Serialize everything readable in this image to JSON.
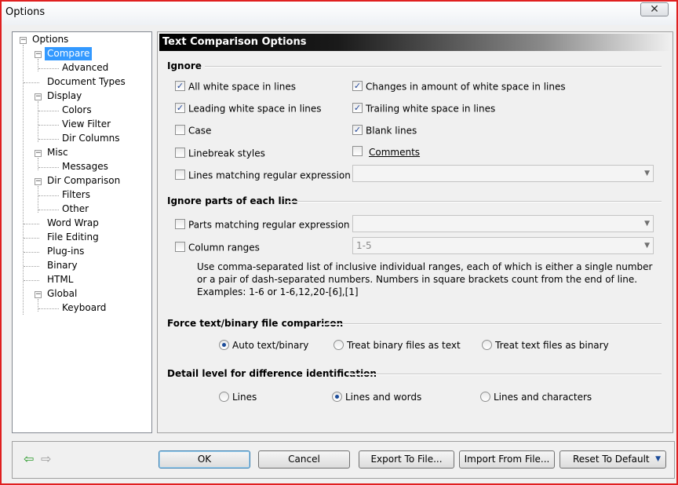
{
  "window": {
    "title": "Options",
    "close_symbol": "✕"
  },
  "tree": {
    "items": [
      {
        "label": "Options",
        "level": 0,
        "expander": "−"
      },
      {
        "label": "Compare",
        "level": 1,
        "expander": "−",
        "selected": true
      },
      {
        "label": "Advanced",
        "level": 2
      },
      {
        "label": "Document Types",
        "level": 1
      },
      {
        "label": "Display",
        "level": 1,
        "expander": "−"
      },
      {
        "label": "Colors",
        "level": 2
      },
      {
        "label": "View Filter",
        "level": 2
      },
      {
        "label": "Dir Columns",
        "level": 2
      },
      {
        "label": "Misc",
        "level": 1,
        "expander": "−"
      },
      {
        "label": "Messages",
        "level": 2
      },
      {
        "label": "Dir Comparison",
        "level": 1,
        "expander": "−"
      },
      {
        "label": "Filters",
        "level": 2
      },
      {
        "label": "Other",
        "level": 2
      },
      {
        "label": "Word Wrap",
        "level": 1
      },
      {
        "label": "File Editing",
        "level": 1
      },
      {
        "label": "Plug-ins",
        "level": 1
      },
      {
        "label": "Binary",
        "level": 1
      },
      {
        "label": "HTML",
        "level": 1
      },
      {
        "label": "Global",
        "level": 1,
        "expander": "−"
      },
      {
        "label": "Keyboard",
        "level": 2
      }
    ]
  },
  "panel": {
    "header": "Text Comparison Options",
    "ignore": {
      "title": "Ignore",
      "all_white_space": {
        "label": "All white space in lines",
        "checked": true
      },
      "changes_white_space": {
        "label": "Changes in amount of white space in lines",
        "checked": true
      },
      "leading_white_space": {
        "label": "Leading white space in lines",
        "checked": true
      },
      "trailing_white_space": {
        "label": "Trailing white space in lines",
        "checked": true
      },
      "case": {
        "label": "Case",
        "checked": false
      },
      "blank_lines": {
        "label": "Blank lines",
        "checked": true
      },
      "linebreak_styles": {
        "label": "Linebreak styles",
        "checked": false
      },
      "comments": {
        "label": "Comments",
        "checked": false
      },
      "lines_matching_regex": {
        "label": "Lines matching regular expression",
        "checked": false,
        "value": ""
      }
    },
    "ignore_parts": {
      "title": "Ignore parts of each line",
      "parts_matching_regex": {
        "label": "Parts matching regular expression",
        "checked": false,
        "value": ""
      },
      "column_ranges": {
        "label": "Column ranges",
        "checked": false,
        "value": "1-5"
      },
      "description": "Use comma-separated list of inclusive individual ranges, each of which is either a single number or a pair of dash-separated numbers. Numbers in square brackets count from the end of line. Examples: 1-6 or 1-6,12,20-[6],[1]"
    },
    "force": {
      "title": "Force text/binary file comparison",
      "options": [
        {
          "label": "Auto text/binary",
          "selected": true
        },
        {
          "label": "Treat binary files as text",
          "selected": false
        },
        {
          "label": "Treat text files as binary",
          "selected": false
        }
      ]
    },
    "detail": {
      "title": "Detail level for difference identification",
      "options": [
        {
          "label": "Lines",
          "selected": false
        },
        {
          "label": "Lines and words",
          "selected": true
        },
        {
          "label": "Lines and characters",
          "selected": false
        }
      ]
    }
  },
  "footer": {
    "back_arrow": "⇦",
    "forward_arrow": "⇨",
    "ok": "OK",
    "cancel": "Cancel",
    "export": "Export To File...",
    "import": "Import From File...",
    "reset": "Reset To Default",
    "reset_drop": "▼"
  },
  "colors": {
    "selection": "#3399ff",
    "check": "#24489a",
    "window_border": "#e02020"
  }
}
